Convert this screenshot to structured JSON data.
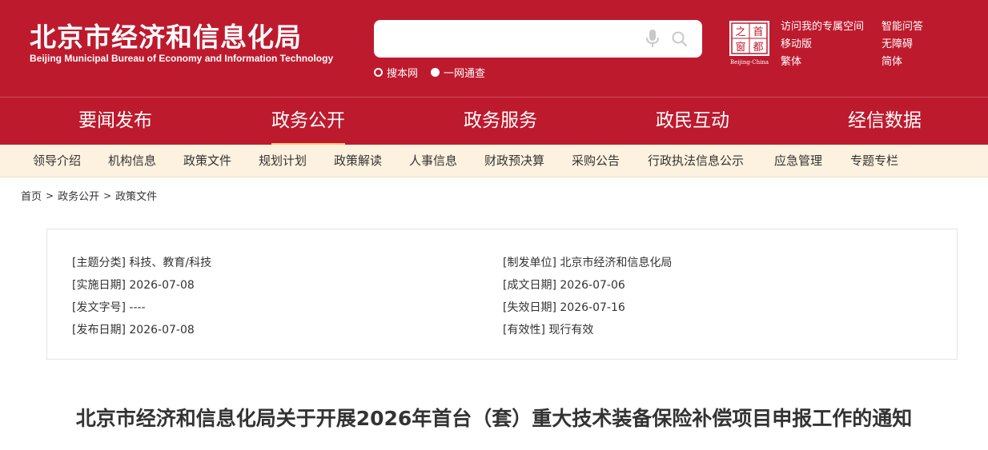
{
  "header": {
    "title": "北京市经济和信息化局",
    "subtitle": "Beijing Municipal Bureau of Economy and Information Technology",
    "search": {
      "value": "",
      "placeholder": ""
    },
    "search_scopes": [
      {
        "label": "搜本网",
        "selected": false
      },
      {
        "label": "一网通查",
        "selected": true
      }
    ],
    "seal": {
      "chars": [
        "首",
        "都",
        "之",
        "窗"
      ],
      "caption": "Beijing-China"
    },
    "quick_links": [
      "访问我的专属空间",
      "智能问答",
      "移动版",
      "无障碍",
      "繁体",
      "简体"
    ]
  },
  "main_nav": {
    "items": [
      "要闻发布",
      "政务公开",
      "政务服务",
      "政民互动",
      "经信数据"
    ],
    "active_index": 1
  },
  "sub_nav": {
    "items": [
      "领导介绍",
      "机构信息",
      "政策文件",
      "规划计划",
      "政策解读",
      "人事信息",
      "财政预决算",
      "采购公告",
      "行政执法信息公示",
      "应急管理",
      "专题专栏"
    ]
  },
  "breadcrumb": {
    "items": [
      "首页",
      "政务公开",
      "政策文件"
    ],
    "separator": ">"
  },
  "info": {
    "left": [
      {
        "label": "[主题分类]",
        "value": "科技、教育/科技"
      },
      {
        "label": "[实施日期]",
        "value": "2026-07-08"
      },
      {
        "label": "[发文字号]",
        "value": "----"
      },
      {
        "label": "[发布日期]",
        "value": "2026-07-08"
      }
    ],
    "right": [
      {
        "label": "[制发单位]",
        "value": "北京市经济和信息化局"
      },
      {
        "label": "[成文日期]",
        "value": "2026-07-06"
      },
      {
        "label": "[失效日期]",
        "value": "2026-07-16"
      },
      {
        "label": "[有效性]",
        "value": "现行有效"
      }
    ]
  },
  "article": {
    "title": "北京市经济和信息化局关于开展2026年首台（套）重大技术装备保险补偿项目申报工作的通知"
  },
  "colors": {
    "brand_red": "#be1a2e",
    "active_underline": "#f7c879",
    "subnav_bg": "#fdf2df"
  }
}
